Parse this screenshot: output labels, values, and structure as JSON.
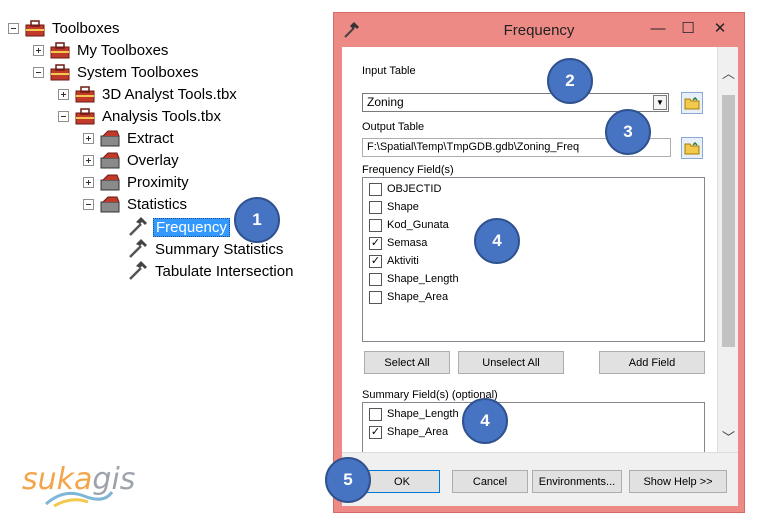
{
  "tree": {
    "root": "Toolboxes",
    "my_toolboxes": "My Toolboxes",
    "system_toolboxes": "System Toolboxes",
    "analyst_3d": "3D Analyst Tools.tbx",
    "analysis": "Analysis Tools.tbx",
    "extract": "Extract",
    "overlay": "Overlay",
    "proximity": "Proximity",
    "statistics": "Statistics",
    "tool_frequency": "Frequency",
    "tool_summary": "Summary Statistics",
    "tool_tabulate": "Tabulate Intersection"
  },
  "badges": {
    "b1": "1",
    "b2": "2",
    "b3": "3",
    "b4a": "4",
    "b4b": "4",
    "b5": "5"
  },
  "logo": {
    "part1": "suka",
    "part2": "gis"
  },
  "dialog": {
    "title": "Frequency",
    "input_table_label": "Input Table",
    "input_table_value": "Zoning",
    "output_table_label": "Output Table",
    "output_table_value": "F:\\Spatial\\Temp\\TmpGDB.gdb\\Zoning_Freq",
    "frequency_fields_label": "Frequency Field(s)",
    "frequency_fields": [
      {
        "name": "OBJECTID",
        "checked": false
      },
      {
        "name": "Shape",
        "checked": false
      },
      {
        "name": "Kod_Gunata",
        "checked": false
      },
      {
        "name": "Semasa",
        "checked": true
      },
      {
        "name": "Aktiviti",
        "checked": true
      },
      {
        "name": "Shape_Length",
        "checked": false
      },
      {
        "name": "Shape_Area",
        "checked": false
      }
    ],
    "select_all": "Select All",
    "unselect_all": "Unselect All",
    "add_field": "Add Field",
    "summary_fields_label": "Summary Field(s) (optional)",
    "summary_fields": [
      {
        "name": "Shape_Length",
        "checked": false
      },
      {
        "name": "Shape_Area",
        "checked": true
      }
    ],
    "ok": "OK",
    "cancel": "Cancel",
    "environments": "Environments...",
    "show_help": "Show Help >>"
  },
  "glyphs": {
    "minimize": "—",
    "maximize": "☐",
    "close": "✕",
    "dropdown": "▼",
    "check": "✓",
    "scroll_up": "︿",
    "scroll_down": "﹀"
  },
  "colors": {
    "dialog_frame": "#ed8a86",
    "badge": "#4674c2",
    "selection": "#3399ff"
  }
}
